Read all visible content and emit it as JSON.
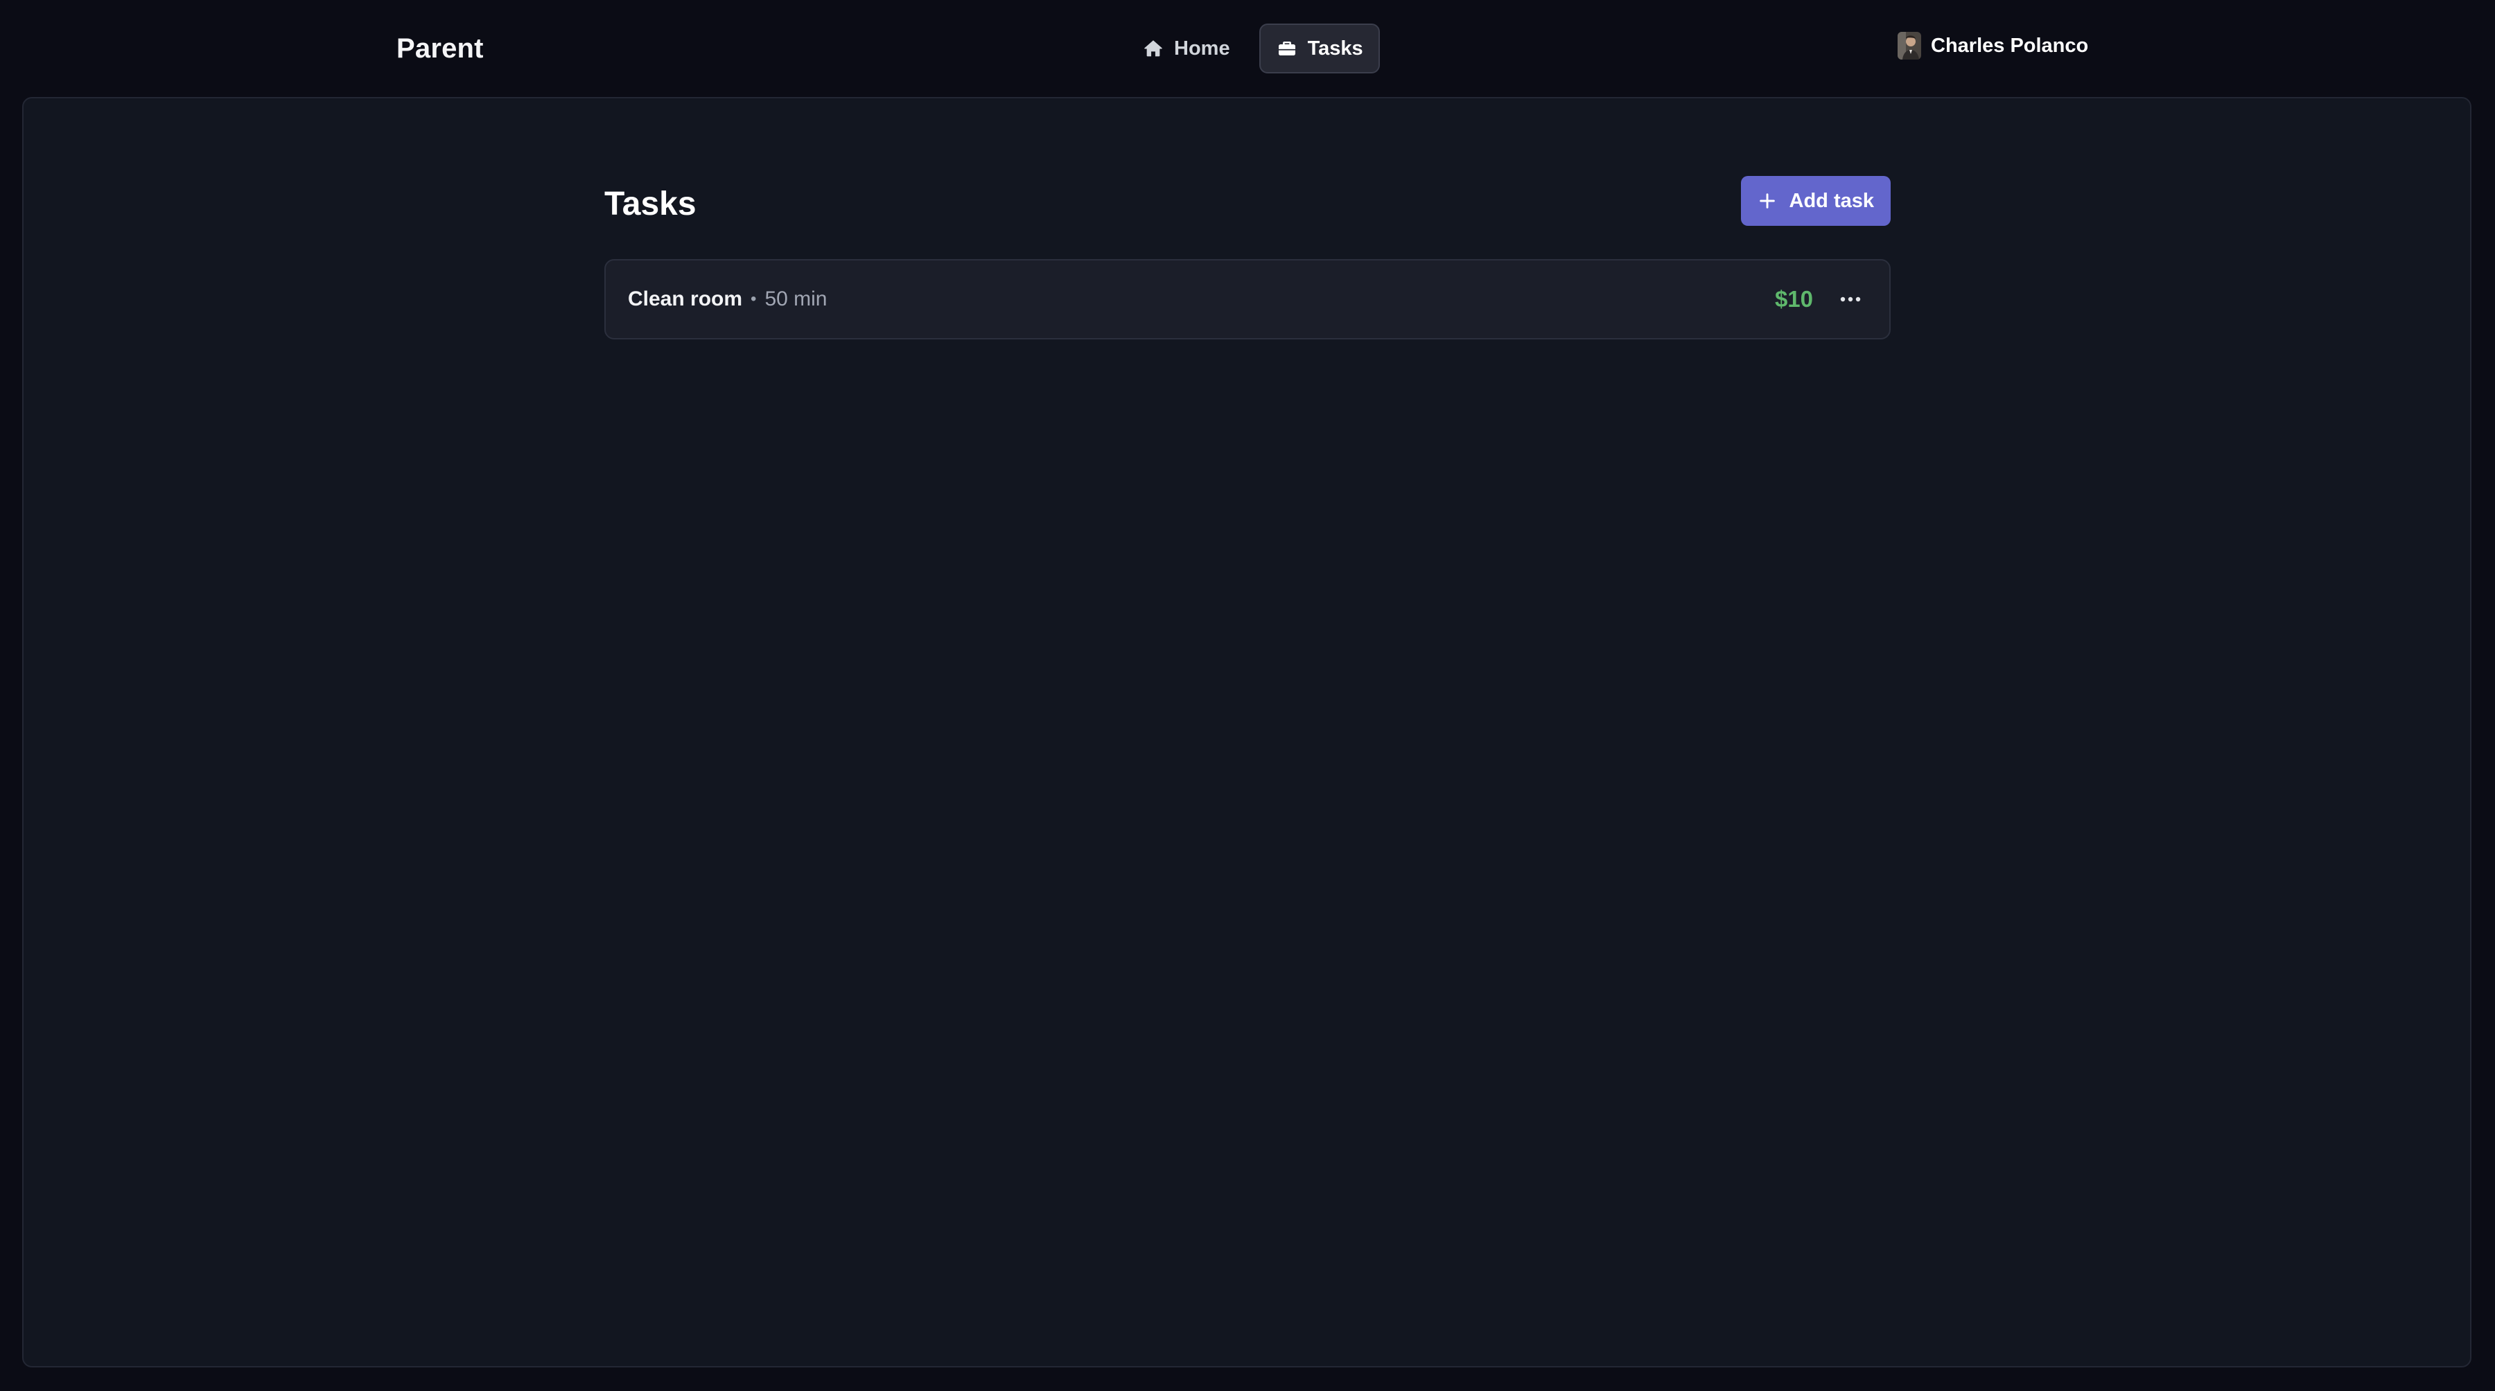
{
  "app": {
    "brand": "Parent"
  },
  "nav": {
    "items": [
      {
        "label": "Home",
        "icon": "home-icon",
        "active": false
      },
      {
        "label": "Tasks",
        "icon": "briefcase-icon",
        "active": true
      }
    ]
  },
  "user": {
    "name": "Charles Polanco"
  },
  "main": {
    "title": "Tasks",
    "add_button_label": "Add task",
    "tasks": [
      {
        "name": "Clean room",
        "separator": "•",
        "duration": "50 min",
        "reward": "$10"
      }
    ]
  },
  "colors": {
    "accent": "#6366cc",
    "reward": "#5fb86c",
    "background": "#0b0c15",
    "panel": "#121620"
  }
}
